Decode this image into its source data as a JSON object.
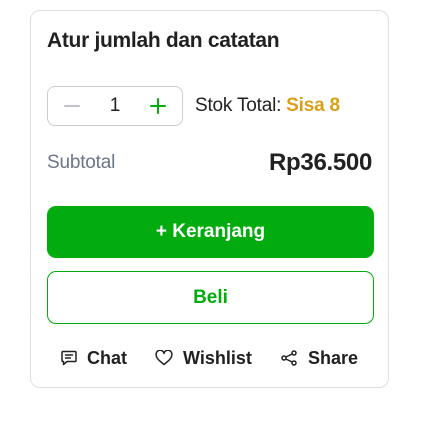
{
  "title": "Atur jumlah dan catatan",
  "quantity": {
    "value": "1",
    "decrement_icon": "minus-icon",
    "increment_icon": "plus-icon"
  },
  "stock": {
    "label": "Stok Total:",
    "value": "Sisa 8"
  },
  "subtotal": {
    "label": "Subtotal",
    "value": "Rp36.500"
  },
  "buttons": {
    "cart": "+ Keranjang",
    "buy": "Beli"
  },
  "actions": [
    {
      "label": "Chat",
      "icon": "chat-icon"
    },
    {
      "label": "Wishlist",
      "icon": "heart-icon"
    },
    {
      "label": "Share",
      "icon": "share-icon"
    }
  ],
  "colors": {
    "primary_green": "#03ac0e",
    "stock_highlight": "#d8a018",
    "muted_text": "#6d7588"
  }
}
